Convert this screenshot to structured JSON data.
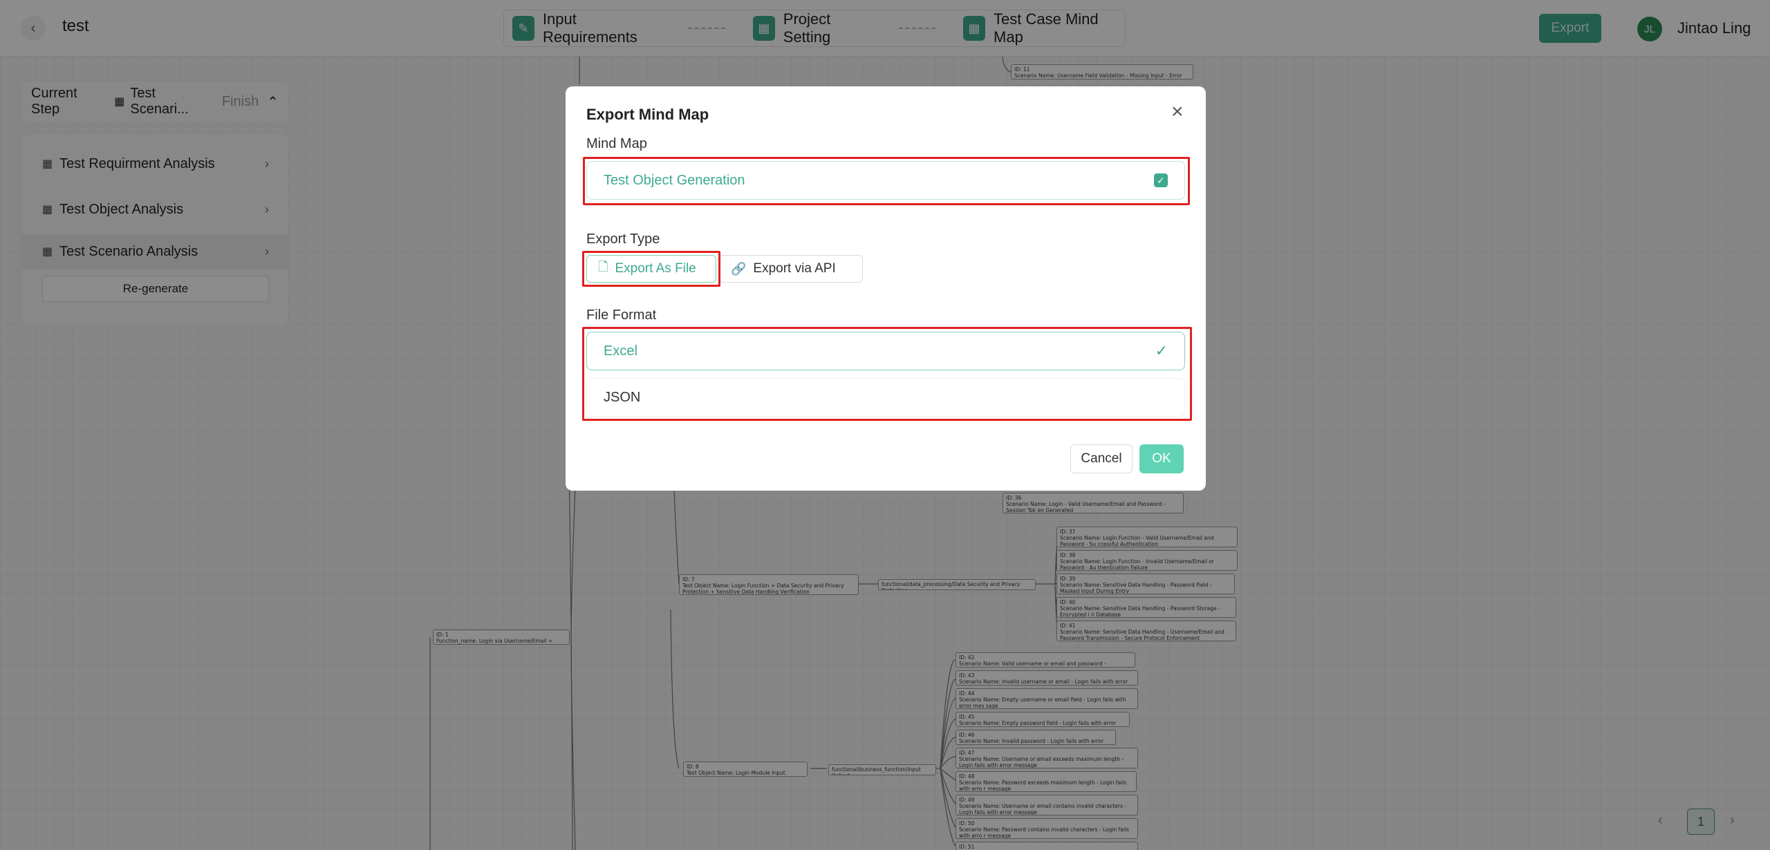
{
  "header": {
    "project_title": "test",
    "steps": [
      {
        "label": "Input Requirements",
        "icon": "edit-icon"
      },
      {
        "label": "Project Setting",
        "icon": "grid-icon"
      },
      {
        "label": "Test Case Mind Map",
        "icon": "grid-icon"
      }
    ],
    "export_label": "Export",
    "user": {
      "initials": "JL",
      "name": "Jintao Ling"
    }
  },
  "sidebar": {
    "current_step_label": "Current Step",
    "current_step_value": "Test Scenari...",
    "current_step_status": "Finish",
    "items": [
      {
        "label": "Test Requirment Analysis"
      },
      {
        "label": "Test Object Analysis"
      },
      {
        "label": "Test Scenario Analysis"
      }
    ],
    "regenerate_label": "Re-generate"
  },
  "mindmap": {
    "root": {
      "id": "ID: 1",
      "text": "Function_name: Login via Username/Email + Password"
    },
    "objects": [
      {
        "id": "ID: 7",
        "text": "Test Object Name: Login Function + Data Security and Privacy Protection + Sensitive Data Handling Verification",
        "category": "functional/data_processing/Data Security and Privacy Protection"
      },
      {
        "id": "ID: 8",
        "text": "Test Object Name: Login Module Input Validation",
        "category": "functional/business_function/Input Output"
      }
    ],
    "top_scenarios": [
      {
        "id": "ID: 11",
        "text": "Scenario Name: Username Field Validation - Missing Input - Error Prompt"
      },
      {
        "id": "ID: 36",
        "text": "Scenario Name: Login - Valid Username/Email and Password - Session Tok en Generated"
      }
    ],
    "obj7_scenarios": [
      {
        "id": "ID: 37",
        "text": "Scenario Name: Login Function - Valid Username/Email and Password - Su ccessful Authentication"
      },
      {
        "id": "ID: 38",
        "text": "Scenario Name: Login Function - Invalid Username/Email or Password - Au thentication Failure"
      },
      {
        "id": "ID: 39",
        "text": "Scenario Name: Sensitive Data Handling - Password Field - Masked Input During Entry"
      },
      {
        "id": "ID: 40",
        "text": "Scenario Name: Sensitive Data Handling - Password Storage - Encrypted i n Database"
      },
      {
        "id": "ID: 41",
        "text": "Scenario Name: Sensitive Data Handling - Username/Email and Password Transmission - Secure Protocol Enforcement"
      }
    ],
    "obj8_scenarios": [
      {
        "id": "ID: 42",
        "text": "Scenario Name: Valid username or email and password - Successful login"
      },
      {
        "id": "ID: 43",
        "text": "Scenario Name: Invalid username or email - Login fails with error message"
      },
      {
        "id": "ID: 44",
        "text": "Scenario Name: Empty username or email field - Login fails with error mes sage"
      },
      {
        "id": "ID: 45",
        "text": "Scenario Name: Empty password field - Login fails with error message"
      },
      {
        "id": "ID: 46",
        "text": "Scenario Name: Invalid password - Login fails with error message"
      },
      {
        "id": "ID: 47",
        "text": "Scenario Name: Username or email exceeds maximum length - Login fails with error message"
      },
      {
        "id": "ID: 48",
        "text": "Scenario Name: Password exceeds maximum length - Login fails with erro r message"
      },
      {
        "id": "ID: 49",
        "text": "Scenario Name: Username or email contains invalid characters - Login fails with error message"
      },
      {
        "id": "ID: 50",
        "text": "Scenario Name: Password contains invalid characters - Login fails with erro r message"
      },
      {
        "id": "ID: 51",
        "text": ""
      }
    ]
  },
  "modal": {
    "title": "Export Mind Map",
    "mind_map_label": "Mind Map",
    "mind_map_value": "Test Object Generation",
    "mind_map_checked": true,
    "export_type_label": "Export Type",
    "export_types": [
      {
        "label": "Export As File",
        "selected": true,
        "icon": "file-icon"
      },
      {
        "label": "Export via API",
        "selected": false,
        "icon": "link-icon"
      }
    ],
    "file_format_label": "File Format",
    "file_formats": [
      {
        "label": "Excel",
        "selected": true
      },
      {
        "label": "JSON",
        "selected": false
      }
    ],
    "cancel_label": "Cancel",
    "ok_label": "OK"
  },
  "pagination": {
    "current_page": "1",
    "prev": "‹",
    "next": "›"
  },
  "colors": {
    "accent": "#3ea98f",
    "highlight_border": "#e02020",
    "ok_button": "#5fd3b3"
  }
}
